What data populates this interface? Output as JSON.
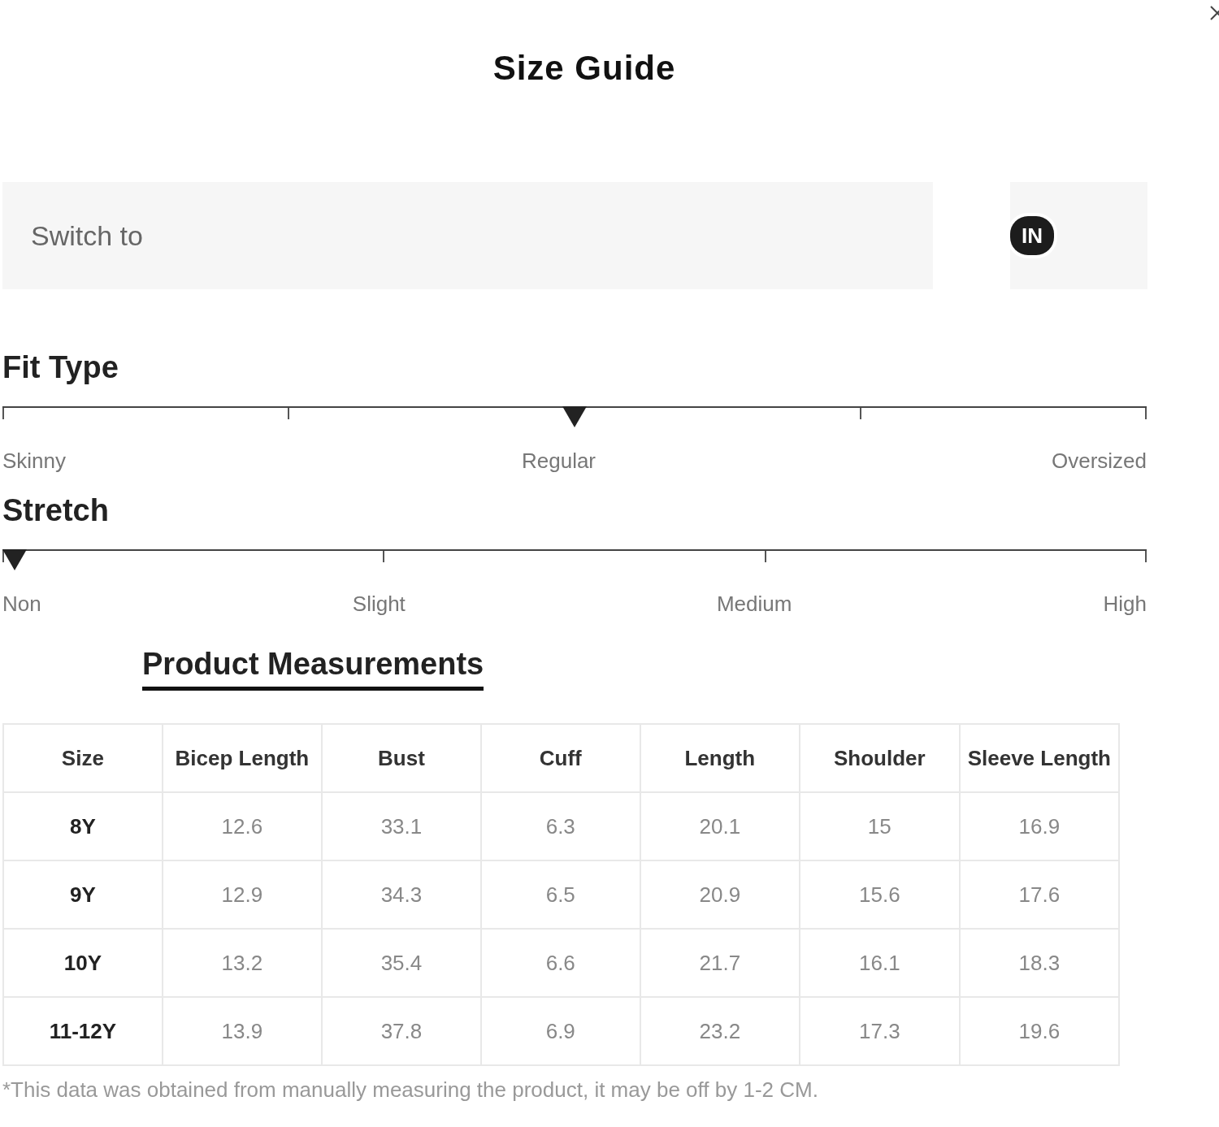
{
  "title": "Size Guide",
  "unit_switch": {
    "label": "Switch to",
    "options": [
      {
        "label": "IN",
        "selected": true
      }
    ]
  },
  "scales": [
    {
      "title": "Fit Type",
      "level": 0.5,
      "labels": [
        "Skinny",
        "Regular",
        "Oversized"
      ]
    },
    {
      "title": "Stretch",
      "level": 0,
      "labels": [
        "Non",
        "Slight",
        "Medium",
        "High"
      ]
    }
  ],
  "tabs": [
    {
      "label": "Product Measurements",
      "selected": true
    }
  ],
  "table": {
    "columns": [
      "Size",
      "Bicep Length",
      "Bust",
      "Cuff",
      "Length",
      "Shoulder",
      "Sleeve Length"
    ],
    "rows": [
      [
        "8Y",
        "12.6",
        "33.1",
        "6.3",
        "20.1",
        "15",
        "16.9"
      ],
      [
        "9Y",
        "12.9",
        "34.3",
        "6.5",
        "20.9",
        "15.6",
        "17.6"
      ],
      [
        "10Y",
        "13.2",
        "35.4",
        "6.6",
        "21.7",
        "16.1",
        "18.3"
      ],
      [
        "11-12Y",
        "13.9",
        "37.8",
        "6.9",
        "23.2",
        "17.3",
        "19.6"
      ]
    ]
  },
  "footnote": "*This data was obtained from manually measuring the product, it may be off by 1-2 CM."
}
